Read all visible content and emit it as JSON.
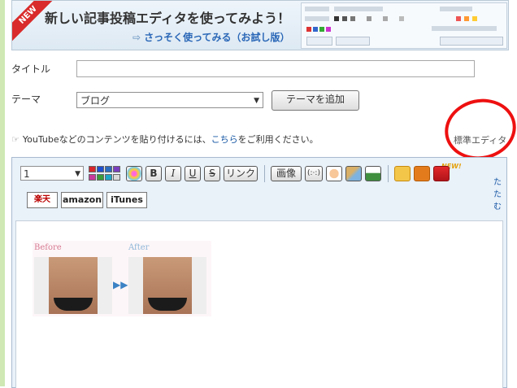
{
  "banner": {
    "new_label": "NEW",
    "title": "新しい記事投稿エディタを使ってみよう！",
    "link": "さっそく使ってみる（お試し版）"
  },
  "form": {
    "title_label": "タイトル",
    "title_value": "",
    "theme_label": "テーマ",
    "theme_selected": "ブログ",
    "add_theme_button": "テーマを追加"
  },
  "notice": {
    "prefix": "YouTubeなどのコンテンツを貼り付けるには、",
    "link": "こちら",
    "suffix": "をご利用ください。"
  },
  "std_editor_label": "標準エディタ",
  "editor": {
    "font_size_selected": "1",
    "buttons": {
      "bold": "B",
      "italic": "I",
      "underline": "U",
      "strike": "S",
      "link": "リンク",
      "image": "画像",
      "emoji": "(:·:)"
    },
    "new_badge": "NEW!",
    "collapse": "たたむ",
    "shops": [
      "楽天",
      "amazon",
      "iTunes"
    ],
    "image_labels": {
      "before": "Before",
      "after": "After"
    }
  },
  "colors": {
    "accent_red": "#ee1010",
    "link_blue": "#1a5aa6",
    "editor_bg": "#e9f1f9"
  }
}
